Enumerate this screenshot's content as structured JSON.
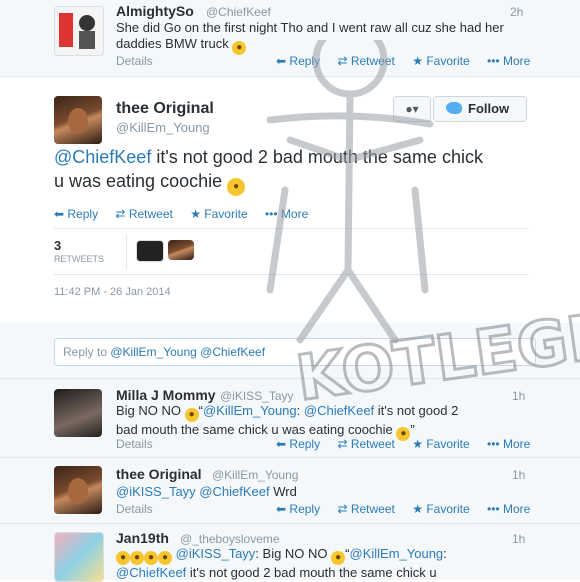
{
  "top_tweet": {
    "name": "AlmightySo",
    "handle": "@ChiefKeef",
    "time": "2h",
    "text": "She did Go on the first night Tho and I went raw all cuz she had her daddies BMW truck",
    "details": "Details",
    "actions": {
      "reply": "Reply",
      "retweet": "Retweet",
      "favorite": "Favorite",
      "more": "More"
    }
  },
  "main_tweet": {
    "name": "thee Original",
    "handle": "@KillEm_Young",
    "follow_label": "Follow",
    "mention": "@ChiefKeef",
    "text": " it's not good 2 bad mouth the same chick u was eating coochie",
    "actions": {
      "reply": "Reply",
      "retweet": "Retweet",
      "favorite": "Favorite",
      "more": "More"
    },
    "retweet_count": "3",
    "retweets_label": "RETWEETS",
    "timestamp": "11:42 PM - 26 Jan 2014"
  },
  "reply_box": {
    "prefix": "Reply to ",
    "mentions": "@KillEm_Young @ChiefKeef"
  },
  "replies": [
    {
      "name": "Milla J Mommy",
      "handle": "@iKISS_Tayy",
      "time": "1h",
      "line1_a": "Big NO NO ",
      "line1_b": "“",
      "line1_mention1": "@KillEm_Young",
      "line1_c": ": ",
      "line1_mention2": "@ChiefKeef",
      "line1_d": " it's not good 2",
      "line2": "bad mouth the same chick u was eating coochie",
      "line2_end": "”",
      "details": "Details",
      "actions": {
        "reply": "Reply",
        "retweet": "Retweet",
        "favorite": "Favorite",
        "more": "More"
      }
    },
    {
      "name": "thee Original",
      "handle": "@KillEm_Young",
      "time": "1h",
      "mention1": "@iKISS_Tayy",
      "mention2": "@ChiefKeef",
      "text": " Wrd",
      "details": "Details",
      "actions": {
        "reply": "Reply",
        "retweet": "Retweet",
        "favorite": "Favorite",
        "more": "More"
      }
    },
    {
      "name": "Jan19th",
      "handle": "@_theboysloveme",
      "time": "1h",
      "mention1": "@iKISS_Tayy",
      "text_a": ": Big NO NO ",
      "text_b": "“",
      "mention2": "@KillEm_Young",
      "text_c": ":",
      "line2_mention": "@ChiefKeef",
      "line2": " it's not good 2 bad mouth the same chick u"
    }
  ],
  "watermark_text": "KOTLEGE KIDD",
  "colors": {
    "link": "#2b7bb9",
    "muted": "#8899a6",
    "row_bg": "#f5f8fa"
  }
}
